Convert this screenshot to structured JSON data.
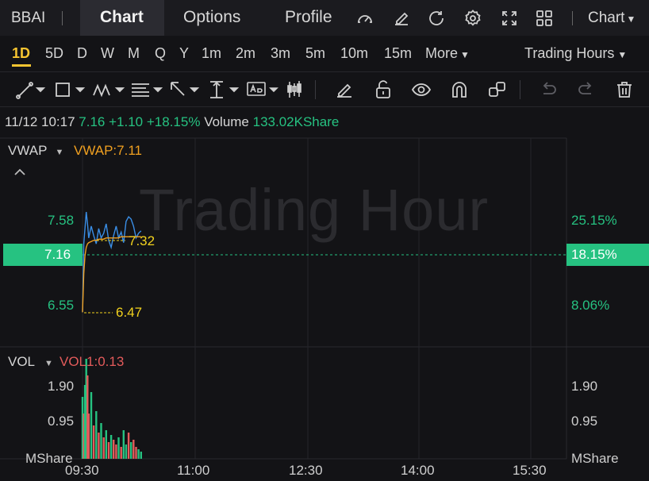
{
  "header": {
    "symbol": "BBAI",
    "tabs": [
      {
        "label": "Chart"
      },
      {
        "label": "Options"
      },
      {
        "label": "Profile"
      }
    ],
    "chart_menu": "Chart",
    "icons": [
      "speedometer-icon",
      "edit-icon",
      "refresh-icon",
      "gear-icon",
      "fullscreen-icon",
      "grid-layout-icon"
    ]
  },
  "periods": {
    "items": [
      "1D",
      "5D",
      "D",
      "W",
      "M",
      "Q",
      "Y",
      "1m",
      "2m",
      "3m",
      "5m",
      "10m",
      "15m"
    ],
    "active": "1D",
    "more": "More",
    "session": "Trading Hours"
  },
  "colors": {
    "up": "#26c281",
    "down": "#e35b5b",
    "price_line": "#3a8ee6",
    "vwap_line": "#f0a020",
    "marker": "#f2d21e",
    "accent": "#f7c531"
  },
  "info": {
    "time": "11/12 10:17",
    "price": "7.16",
    "change": "+1.10",
    "change_pct": "+18.15%",
    "volume_label": "Volume",
    "volume": "133.02KShare"
  },
  "price_panel": {
    "indicator": "VWAP",
    "vwap_label": "VWAP:7.11",
    "watermark": "Trading Hour",
    "left_ticks": [
      "7.58",
      "6.55"
    ],
    "right_ticks": [
      "25.15%",
      "8.06%"
    ],
    "current_price": "7.16",
    "current_pct": "18.15%",
    "high_label": "7.32",
    "low_label": "6.47"
  },
  "volume_panel": {
    "indicator": "VOL",
    "vol_label": "VOL1:0.13",
    "left_ticks": [
      "1.90",
      "0.95",
      "MShare"
    ],
    "right_ticks": [
      "1.90",
      "0.95",
      "MShare"
    ]
  },
  "x_ticks": [
    "09:30",
    "11:00",
    "12:30",
    "14:00",
    "15:30"
  ],
  "chart_data": {
    "type": "line",
    "x": [
      "09:30",
      "09:31",
      "09:32",
      "09:33",
      "09:34",
      "09:35",
      "09:37",
      "09:39",
      "09:41",
      "09:43",
      "09:45",
      "09:47",
      "09:49",
      "09:51",
      "09:53",
      "09:55",
      "09:57",
      "09:59",
      "10:01",
      "10:03",
      "10:05",
      "10:07",
      "10:09",
      "10:11",
      "10:13",
      "10:15",
      "10:17"
    ],
    "series": [
      {
        "values": [
          6.47,
          7.05,
          7.18,
          7.32,
          7.22,
          7.1,
          7.2,
          7.12,
          7.05,
          7.18,
          7.1,
          7.14,
          7.22,
          7.08,
          7.02,
          7.12,
          7.2,
          7.1,
          7.15,
          7.06,
          7.24,
          7.28,
          7.26,
          7.2,
          7.1,
          7.14,
          7.16
        ]
      },
      {
        "values": [
          6.47,
          6.8,
          6.95,
          7.02,
          7.05,
          7.06,
          7.07,
          7.08,
          7.08,
          7.09,
          7.09,
          7.09,
          7.1,
          7.1,
          7.1,
          7.1,
          7.1,
          7.1,
          7.11,
          7.11,
          7.11,
          7.11,
          7.11,
          7.11,
          7.11,
          7.11,
          7.11
        ]
      }
    ],
    "ylim": [
      6.21,
      7.92
    ],
    "volume": {
      "values": [
        1.3,
        0.95,
        1.55,
        2.1,
        1.75,
        0.95,
        1.4,
        0.7,
        1.0,
        0.55,
        0.75,
        0.45,
        0.6,
        0.35,
        0.5,
        0.4,
        0.3,
        0.45,
        0.25,
        0.6,
        0.3,
        0.55,
        0.35,
        0.4,
        0.25,
        0.2,
        0.15
      ],
      "up": [
        true,
        false,
        true,
        true,
        false,
        false,
        true,
        false,
        true,
        false,
        true,
        false,
        true,
        false,
        true,
        false,
        false,
        true,
        false,
        true,
        true,
        false,
        true,
        false,
        false,
        true,
        true
      ],
      "ylim": [
        0,
        2.3
      ]
    }
  }
}
